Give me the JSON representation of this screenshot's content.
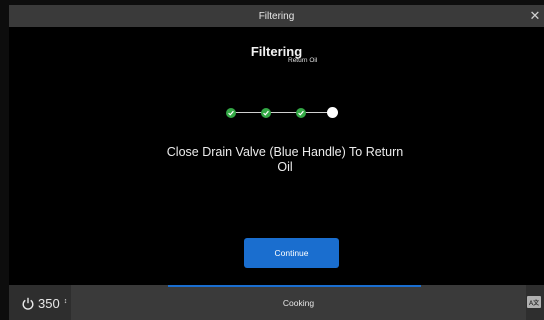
{
  "window": {
    "title": "Filtering"
  },
  "main": {
    "heading": "Filtering",
    "current_step_label": "Return Oil",
    "instruction": "Close Drain Valve (Blue Handle) To Return Oil",
    "continue_label": "Continue"
  },
  "footer": {
    "power_value": "350",
    "power_unit": "↕",
    "mode_label": "Cooking",
    "lang_icon_text": "A文"
  },
  "colors": {
    "accent": "#1a6ecf",
    "done": "#33a845"
  }
}
